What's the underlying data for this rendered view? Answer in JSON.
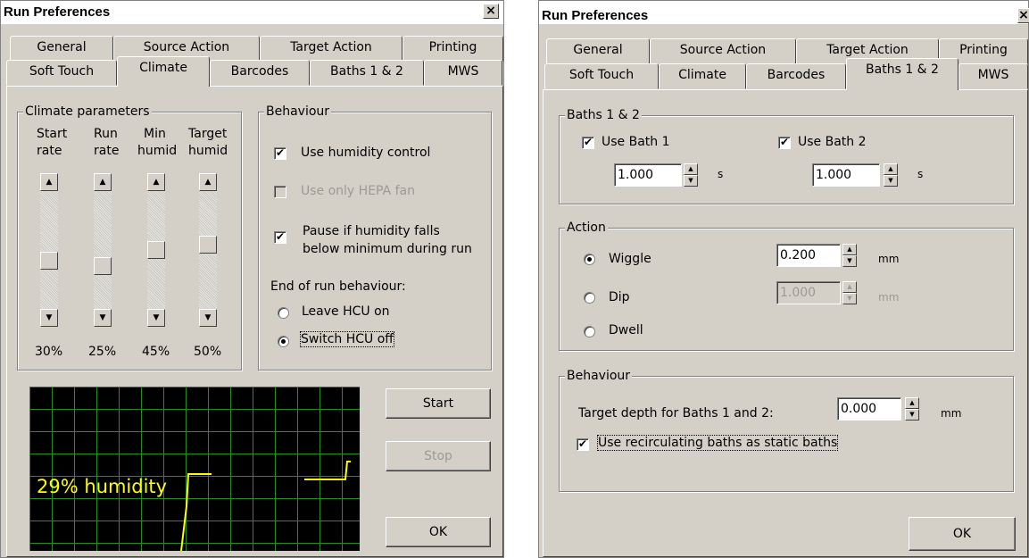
{
  "left_window": {
    "title": "Run Preferences",
    "close": "×",
    "tabs_back": [
      "General",
      "Source Action",
      "Target Action",
      "Printing"
    ],
    "tabs_front": [
      "Soft Touch",
      "Climate",
      "Barcodes",
      "Baths 1 & 2",
      "MWS"
    ],
    "selected_tab": "Climate",
    "climate_group": {
      "label": "Climate parameters",
      "sliders": [
        {
          "top": "Start",
          "bottom": "rate",
          "value_text": "30%",
          "value": 30
        },
        {
          "top": "Run",
          "bottom": "rate",
          "value_text": "25%",
          "value": 25
        },
        {
          "top": "Min",
          "bottom": "humid",
          "value_text": "45%",
          "value": 45
        },
        {
          "top": "Target",
          "bottom": "humid",
          "value_text": "50%",
          "value": 50
        }
      ]
    },
    "behaviour_group": {
      "label": "Behaviour",
      "use_humidity": {
        "label": "Use humidity control",
        "checked": true
      },
      "use_hepa": {
        "label": "Use only HEPA fan",
        "checked": false,
        "disabled": true
      },
      "pause_line1": "Pause if humidity falls",
      "pause_line2": "below minimum during run",
      "pause_checked": true,
      "end_label": "End of run behaviour:",
      "leave_on": "Leave HCU on",
      "switch_off": "Switch HCU off",
      "selected": "Switch HCU off"
    },
    "graph_text": "29% humidity",
    "start_button": "Start",
    "stop_button": "Stop",
    "ok_button": "OK"
  },
  "right_window": {
    "title": "Run Preferences",
    "close": "×",
    "tabs_back": [
      "General",
      "Source Action",
      "Target Action",
      "Printing"
    ],
    "tabs_front": [
      "Soft Touch",
      "Climate",
      "Barcodes",
      "Baths 1 & 2",
      "MWS"
    ],
    "selected_tab": "Baths 1 & 2",
    "baths_group": {
      "label": "Baths 1 & 2",
      "bath1": {
        "label": "Use Bath 1",
        "checked": true,
        "value": "1.000",
        "unit": "s"
      },
      "bath2": {
        "label": "Use Bath 2",
        "checked": true,
        "value": "1.000",
        "unit": "s"
      }
    },
    "action_group": {
      "label": "Action",
      "wiggle": {
        "label": "Wiggle",
        "value": "0.200",
        "unit": "mm",
        "selected": true
      },
      "dip": {
        "label": "Dip",
        "value": "1.000",
        "unit": "mm",
        "disabled": true
      },
      "dwell": {
        "label": "Dwell"
      }
    },
    "behaviour_group": {
      "label": "Behaviour",
      "target_depth_label": "Target depth for Baths 1 and 2:",
      "target_depth_value": "0.000",
      "target_depth_unit": "mm",
      "recirc_label": "Use recirculating baths as static baths",
      "recirc_checked": true
    },
    "ok_button": "OK"
  },
  "colors": {
    "dialog_bg": "#d4d0c8",
    "graph_bg": "#000000",
    "graph_grid": "#2a8a2a",
    "graph_text": "#ffff00"
  },
  "icons": {
    "up_arrow": "▲",
    "down_arrow": "▼",
    "check": "✔"
  }
}
